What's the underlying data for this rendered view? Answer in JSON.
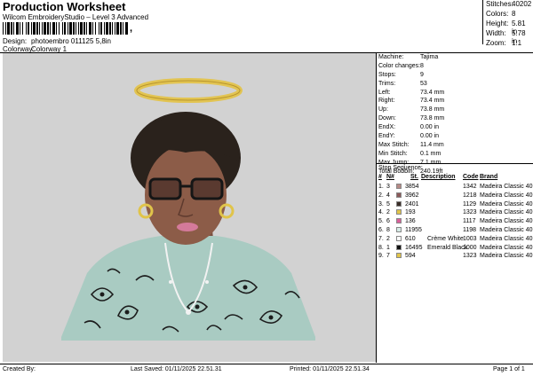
{
  "header": {
    "title": "Production Worksheet",
    "subtitle": "Wilcom EmbroideryStudio – Level 3 Advanced",
    "comma_mark": ",",
    "design_label": "Design:",
    "design_value": "photoembro 011125 5,8in",
    "colorway_label": "Colorway:",
    "colorway_value": "Colorway 1"
  },
  "stats": [
    {
      "label": "Stitches:",
      "value": "40202"
    },
    {
      "label": "Colors:",
      "value": "8"
    },
    {
      "label": "Height:",
      "value": "5.81 in"
    },
    {
      "label": "Width:",
      "value": "5.78 in"
    },
    {
      "label": "Zoom:",
      "value": "1:1"
    }
  ],
  "info": [
    {
      "label": "Machine:",
      "value": "Tajima"
    },
    {
      "label": "Color changes:",
      "value": "8"
    },
    {
      "label": "Stops:",
      "value": "9"
    },
    {
      "label": "Trims:",
      "value": "53"
    },
    {
      "label": "Left:",
      "value": "73.4 mm"
    },
    {
      "label": "Right:",
      "value": "73.4 mm"
    },
    {
      "label": "Up:",
      "value": "73.8 mm"
    },
    {
      "label": "Down:",
      "value": "73.8 mm"
    },
    {
      "label": "EndX:",
      "value": "0.00 in"
    },
    {
      "label": "EndY:",
      "value": "0.00 in"
    },
    {
      "label": "Max Stitch:",
      "value": "11.4 mm"
    },
    {
      "label": "Min Stitch:",
      "value": "0.1 mm"
    },
    {
      "label": "Max Jump:",
      "value": "7.1 mm"
    },
    {
      "label": "Total Bobbin:",
      "value": "240.19ft"
    }
  ],
  "sequence": {
    "heading": "Stop Sequence:",
    "columns": {
      "hash": "#",
      "n": "N#",
      "st": "St.",
      "desc": "Description",
      "code": "Code",
      "brand": "Brand"
    },
    "rows": [
      {
        "num": "1.",
        "n": "3",
        "color": "#b58a86",
        "st": "3854",
        "desc": "",
        "code": "1342",
        "brand": "Madeira Classic 40"
      },
      {
        "num": "2.",
        "n": "4",
        "color": "#8a5a5a",
        "st": "3962",
        "desc": "",
        "code": "1218",
        "brand": "Madeira Classic 40"
      },
      {
        "num": "3.",
        "n": "5",
        "color": "#3a2e28",
        "st": "2401",
        "desc": "",
        "code": "1129",
        "brand": "Madeira Classic 40"
      },
      {
        "num": "4.",
        "n": "2",
        "color": "#e0c44a",
        "st": "193",
        "desc": "",
        "code": "1323",
        "brand": "Madeira Classic 40"
      },
      {
        "num": "5.",
        "n": "6",
        "color": "#d8609a",
        "st": "136",
        "desc": "",
        "code": "1117",
        "brand": "Madeira Classic 40"
      },
      {
        "num": "6.",
        "n": "8",
        "color": "#d6ece6",
        "st": "11955",
        "desc": "",
        "code": "1198",
        "brand": "Madeira Classic 40"
      },
      {
        "num": "7.",
        "n": "2",
        "color": "#ffffff",
        "st": "610",
        "desc": "Crème White",
        "code": "1003",
        "brand": "Madeira Classic 40"
      },
      {
        "num": "8.",
        "n": "1",
        "color": "#111111",
        "st": "16495",
        "desc": "Emerald Black",
        "code": "1000",
        "brand": "Madeira Classic 40"
      },
      {
        "num": "9.",
        "n": "7",
        "color": "#e0c44a",
        "st": "594",
        "desc": "",
        "code": "1323",
        "brand": "Madeira Classic 40"
      }
    ]
  },
  "footer": {
    "created_by": "Created By:",
    "last_saved": "Last Saved: 01/11/2025 22.51.31",
    "printed": "Printed: 01/11/2025 22.51.34",
    "page": "Page 1 of 1"
  }
}
